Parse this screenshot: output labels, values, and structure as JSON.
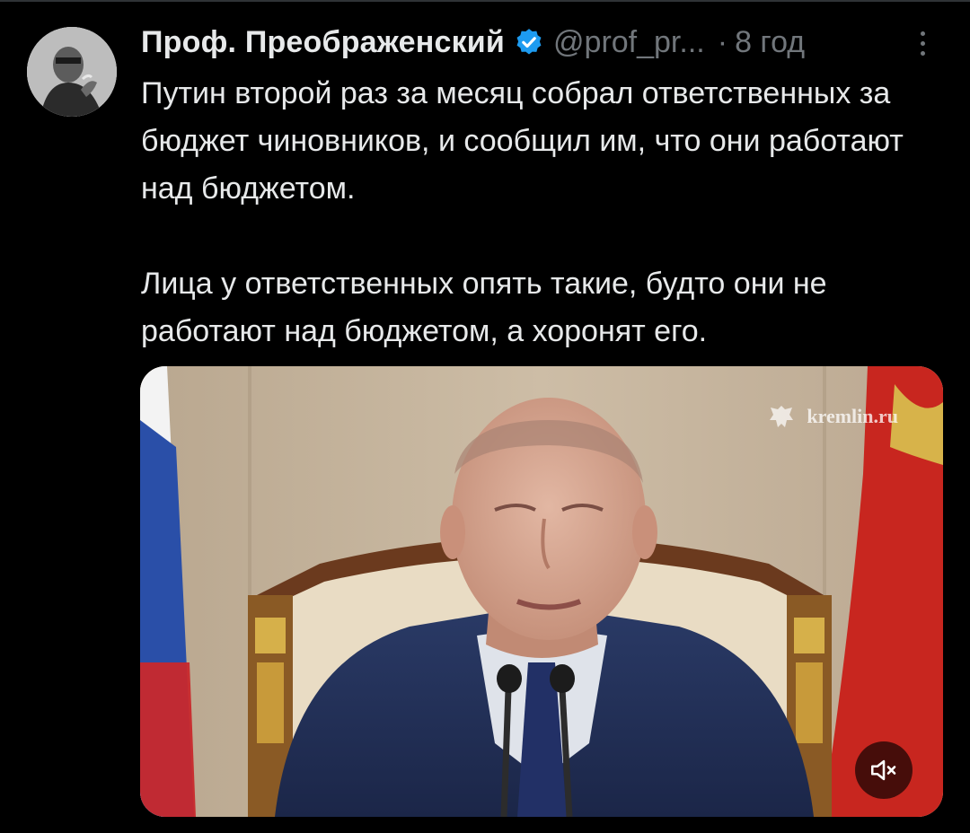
{
  "tweet": {
    "author": {
      "display_name": "Проф. Преображенский",
      "handle": "@prof_pr...",
      "verified": true
    },
    "separator": "·",
    "timestamp": "8 год",
    "text": {
      "paragraph_1": "Путин второй раз за месяц собрал ответственных за бюджет чиновников, и сообщил им, что они работают над бюджетом.",
      "paragraph_2": "Лица у ответственных опять такие, будто они не работают над бюджетом, а хоронят его."
    },
    "media": {
      "watermark": "kremlin.ru",
      "muted": true
    }
  },
  "icons": {
    "verified": "verified-badge-icon",
    "more": "more-options-icon",
    "mute": "volume-muted-icon",
    "emblem": "coat-of-arms-icon"
  },
  "colors": {
    "background": "#000000",
    "text_primary": "#e7e9ea",
    "text_secondary": "#71767b",
    "verified_blue": "#1d9bf0"
  }
}
